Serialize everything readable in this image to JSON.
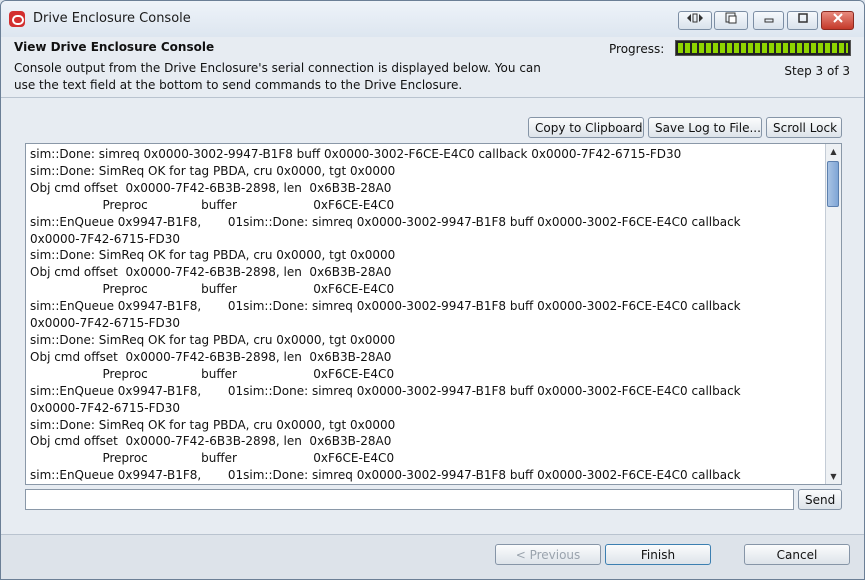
{
  "window": {
    "title": "Drive Enclosure Console",
    "controls": [
      "restore-icon",
      "tile-icon",
      "minimize-icon",
      "maximize-icon",
      "close-icon"
    ]
  },
  "header": {
    "title": "View Drive Enclosure Console",
    "description": "Console output from the Drive Enclosure's serial connection is displayed below.  You can use the text field at the bottom to send commands to the Drive Enclosure.",
    "progress_label": "Progress:",
    "progress_fraction": 1.0,
    "step": "Step 3 of 3"
  },
  "toolbar": {
    "copy_label": "Copy to Clipboard",
    "save_label": "Save Log to File...",
    "scroll_lock_label": "Scroll Lock"
  },
  "console": {
    "lines": [
      "sim::Done: simreq 0x0000-3002-9947-B1F8 buff 0x0000-3002-F6CE-E4C0 callback 0x0000-7F42-6715-FD30",
      "sim::Done: SimReq OK for tag PBDA, cru 0x0000, tgt 0x0000",
      "Obj cmd offset  0x0000-7F42-6B3B-2898, len  0x6B3B-28A0",
      "                   Preproc              buffer                    0xF6CE-E4C0",
      "sim::EnQueue 0x9947-B1F8,       01sim::Done: simreq 0x0000-3002-9947-B1F8 buff 0x0000-3002-F6CE-E4C0 callback",
      "0x0000-7F42-6715-FD30",
      "sim::Done: SimReq OK for tag PBDA, cru 0x0000, tgt 0x0000",
      "Obj cmd offset  0x0000-7F42-6B3B-2898, len  0x6B3B-28A0",
      "                   Preproc              buffer                    0xF6CE-E4C0",
      "sim::EnQueue 0x9947-B1F8,       01sim::Done: simreq 0x0000-3002-9947-B1F8 buff 0x0000-3002-F6CE-E4C0 callback",
      "0x0000-7F42-6715-FD30",
      "sim::Done: SimReq OK for tag PBDA, cru 0x0000, tgt 0x0000",
      "Obj cmd offset  0x0000-7F42-6B3B-2898, len  0x6B3B-28A0",
      "                   Preproc              buffer                    0xF6CE-E4C0",
      "sim::EnQueue 0x9947-B1F8,       01sim::Done: simreq 0x0000-3002-9947-B1F8 buff 0x0000-3002-F6CE-E4C0 callback",
      "0x0000-7F42-6715-FD30",
      "sim::Done: SimReq OK for tag PBDA, cru 0x0000, tgt 0x0000",
      "Obj cmd offset  0x0000-7F42-6B3B-2898, len  0x6B3B-28A0",
      "                   Preproc              buffer                    0xF6CE-E4C0",
      "sim::EnQueue 0x9947-B1F8,       01sim::Done: simreq 0x0000-3002-9947-B1F8 buff 0x0000-3002-F6CE-E4C0 callback"
    ]
  },
  "command": {
    "value": "",
    "send_label": "Send"
  },
  "footer": {
    "previous_label": "< Previous",
    "finish_label": "Finish",
    "cancel_label": "Cancel"
  },
  "colors": {
    "progress": "#8fd400",
    "close_button": "#c4392a"
  }
}
